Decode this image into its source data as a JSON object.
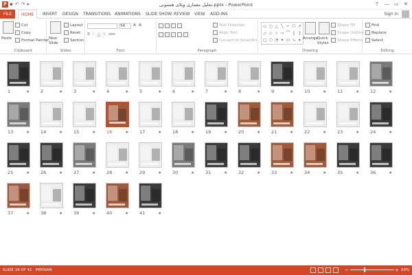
{
  "window": {
    "title": "تحلیل معماری ویلای هستونی.pptx - PowerPoint",
    "app_icon": "P",
    "min": "—",
    "restore": "▭",
    "close": "✕",
    "help": "?"
  },
  "tabs": [
    {
      "label": "FILE"
    },
    {
      "label": "HOME"
    },
    {
      "label": "INSERT"
    },
    {
      "label": "DESIGN"
    },
    {
      "label": "TRANSITIONS"
    },
    {
      "label": "ANIMATIONS"
    },
    {
      "label": "SLIDE SHOW"
    },
    {
      "label": "REVIEW"
    },
    {
      "label": "VIEW"
    },
    {
      "label": "ADD-INS"
    }
  ],
  "signin": "Sign in",
  "ribbon": {
    "clipboard": {
      "label": "Clipboard",
      "paste": "Paste",
      "cut": "Cut",
      "copy": "Copy",
      "format_painter": "Format Painter"
    },
    "slides": {
      "label": "Slides",
      "new_slide": "New Slide",
      "layout": "Layout",
      "reset": "Reset",
      "section": "Section"
    },
    "font": {
      "label": "Font",
      "size": "54",
      "bold": "B",
      "italic": "I",
      "underline": "U",
      "shadow": "S",
      "strike": "abc"
    },
    "paragraph": {
      "label": "Paragraph",
      "text_direction": "Text Direction",
      "align_text": "Align Text",
      "convert": "Convert to SmartArt"
    },
    "drawing": {
      "label": "Drawing",
      "arrange": "Arrange",
      "quick_styles": "Quick Styles",
      "shape_fill": "Shape Fill",
      "shape_outline": "Shape Outline",
      "shape_effects": "Shape Effects"
    },
    "editing": {
      "label": "Editing",
      "find": "Find",
      "replace": "Replace",
      "select": "Select"
    }
  },
  "slides": [
    "1",
    "2",
    "3",
    "4",
    "5",
    "6",
    "7",
    "8",
    "9",
    "10",
    "11",
    "12",
    "13",
    "14",
    "15",
    "16",
    "17",
    "18",
    "19",
    "20",
    "21",
    "22",
    "23",
    "24",
    "25",
    "26",
    "27",
    "28",
    "29",
    "30",
    "31",
    "32",
    "33",
    "34",
    "35",
    "36",
    "37",
    "38",
    "39",
    "40",
    "41"
  ],
  "star": "★",
  "selected_slide": "16",
  "status": {
    "slide": "SLIDE 16 OF 41",
    "language": "PERSIAN",
    "zoom": "50%",
    "zoom_out": "−",
    "zoom_in": "+"
  }
}
